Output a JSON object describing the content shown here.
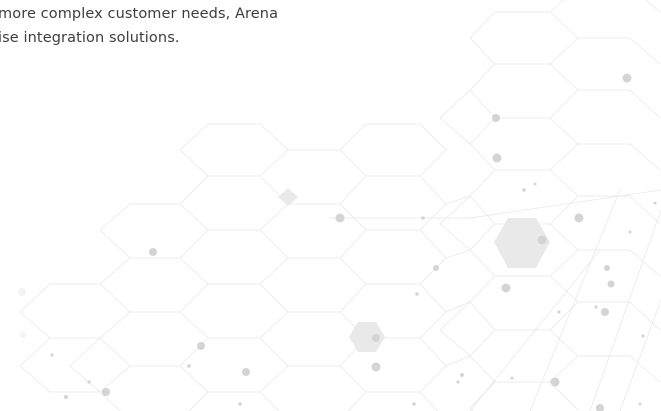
{
  "content": {
    "paragraph_lines": [
      "more complex customer needs, Arena",
      "ise integration solutions."
    ]
  },
  "background": {
    "pattern_icon": "hexagon-network-pattern",
    "line_color": "#e4e4e4",
    "node_color": "#d4d4d4",
    "hexagon_fill_color": "#e9e9e9"
  }
}
